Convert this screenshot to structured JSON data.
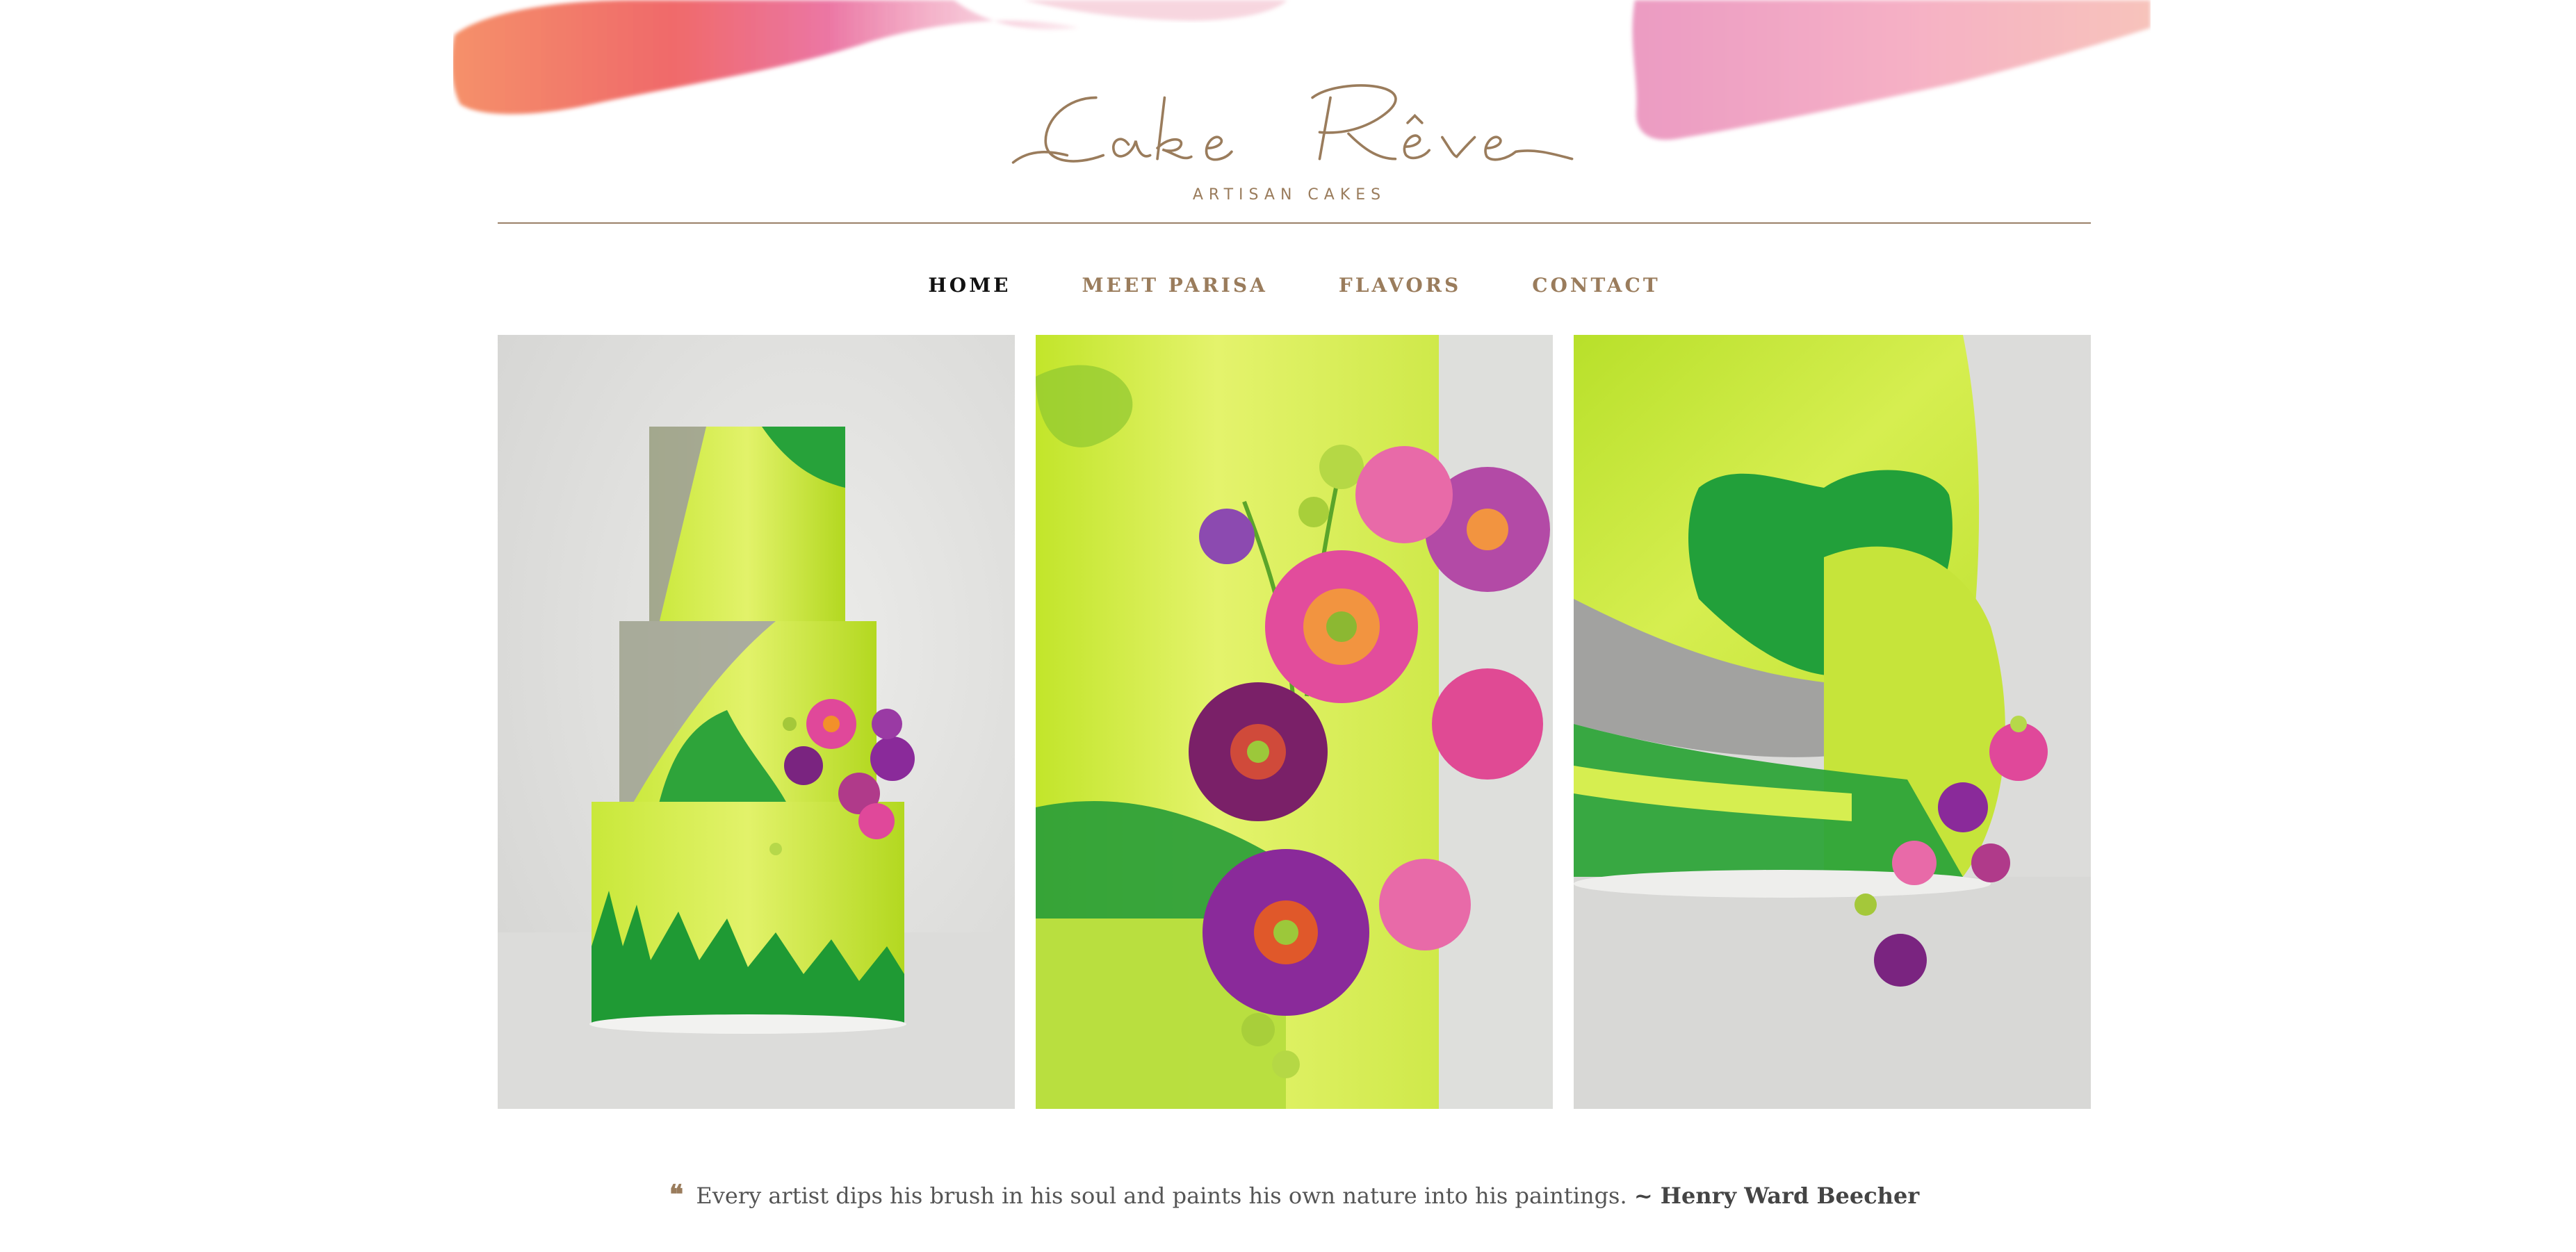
{
  "brand": {
    "name": "Cake Rêve",
    "tagline": "ARTISAN CAKES",
    "color": "#9a7c5c"
  },
  "nav": {
    "items": [
      {
        "label": "HOME",
        "active": true
      },
      {
        "label": "MEET PARISA",
        "active": false
      },
      {
        "label": "FLAVORS",
        "active": false
      },
      {
        "label": "CONTACT",
        "active": false
      }
    ]
  },
  "gallery": {
    "photos": [
      {
        "subject": "three-tier green watercolor cake with sugar flowers"
      },
      {
        "subject": "close-up of sugar flowers on green cake"
      },
      {
        "subject": "top-down view of green cake tiers"
      }
    ]
  },
  "quote": {
    "icon": "quote-icon",
    "text": "Every artist dips his brush in his soul and paints his own nature into his paintings.",
    "author": "~ Henry Ward Beecher"
  },
  "colors": {
    "accent": "#9a7c5c",
    "nav_active": "#111111",
    "cake_green": "#a9d62a",
    "cake_dark_green": "#2ea43a",
    "flower_pink": "#e0489a",
    "flower_purple": "#8a2a9a"
  }
}
